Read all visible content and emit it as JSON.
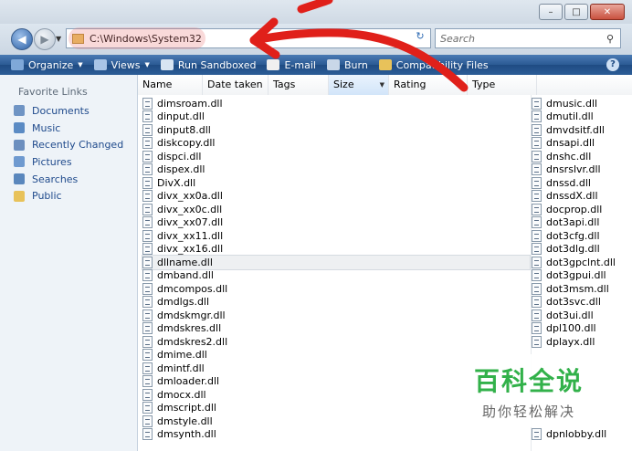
{
  "address": {
    "path": "C:\\Windows\\System32"
  },
  "search": {
    "placeholder": "Search"
  },
  "toolbar": {
    "items": [
      {
        "label": "Organize",
        "icon": "organize-icon",
        "color": "#7fa8d8",
        "dropdown": true
      },
      {
        "label": "Views",
        "icon": "views-icon",
        "color": "#a8c4e6",
        "dropdown": true
      },
      {
        "label": "Run Sandboxed",
        "icon": "sandbox-icon",
        "color": "#d8e4f2",
        "dropdown": false
      },
      {
        "label": "E-mail",
        "icon": "email-icon",
        "color": "#f0f0f0",
        "dropdown": false
      },
      {
        "label": "Burn",
        "icon": "burn-icon",
        "color": "#c9d7e8",
        "dropdown": false
      },
      {
        "label": "Compatibility Files",
        "icon": "compat-icon",
        "color": "#e8c25a",
        "dropdown": false
      }
    ]
  },
  "nav": {
    "title": "Favorite Links",
    "items": [
      {
        "label": "Documents",
        "icon": "documents-icon",
        "color": "#6f94c4"
      },
      {
        "label": "Music",
        "icon": "music-icon",
        "color": "#5b8bc4"
      },
      {
        "label": "Recently Changed",
        "icon": "recent-icon",
        "color": "#6c8fbf"
      },
      {
        "label": "Pictures",
        "icon": "pictures-icon",
        "color": "#6f9ad0"
      },
      {
        "label": "Searches",
        "icon": "searches-icon",
        "color": "#5a87bd"
      },
      {
        "label": "Public",
        "icon": "public-folder-icon",
        "color": "#e8c25a"
      }
    ]
  },
  "columns": [
    "Name",
    "Date taken",
    "Tags",
    "Size",
    "Rating",
    "Type"
  ],
  "files_left": [
    "dimsroam.dll",
    "dinput.dll",
    "dinput8.dll",
    "diskcopy.dll",
    "dispci.dll",
    "dispex.dll",
    "DivX.dll",
    "divx_xx0a.dll",
    "divx_xx0c.dll",
    "divx_xx07.dll",
    "divx_xx11.dll",
    "divx_xx16.dll",
    "dllname.dll",
    "dmband.dll",
    "dmcompos.dll",
    "dmdlgs.dll",
    "dmdskmgr.dll",
    "dmdskres.dll",
    "dmdskres2.dll",
    "dmime.dll",
    "dmintf.dll",
    "dmloader.dll",
    "dmocx.dll",
    "dmscript.dll",
    "dmstyle.dll",
    "dmsynth.dll"
  ],
  "selected_file": "dllname.dll",
  "files_right": [
    "dmusic.dll",
    "dmutil.dll",
    "dmvdsitf.dll",
    "dnsapi.dll",
    "dnshc.dll",
    "dnsrslvr.dll",
    "dnssd.dll",
    "dnssdX.dll",
    "docprop.dll",
    "dot3api.dll",
    "dot3cfg.dll",
    "dot3dlg.dll",
    "dot3gpclnt.dll",
    "dot3gpui.dll",
    "dot3msm.dll",
    "dot3svc.dll",
    "dot3ui.dll",
    "dpl100.dll",
    "dplayx.dll",
    "",
    "",
    "",
    "",
    "",
    "",
    "dpnlobby.dll"
  ],
  "watermark": {
    "main": "百科全说",
    "sub": "助你轻松解决"
  },
  "colors": {
    "arrow": "#e0201a",
    "commandbar": "#2b5a94",
    "link": "#1f4a8c"
  }
}
